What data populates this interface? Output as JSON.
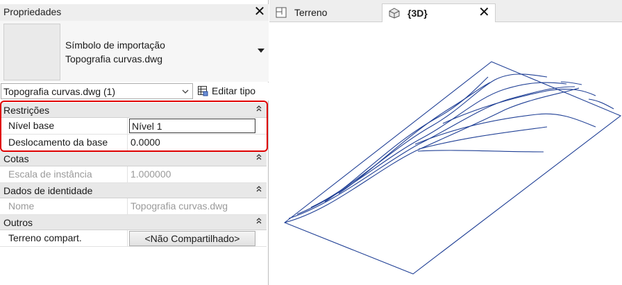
{
  "panel": {
    "title": "Propriedades",
    "close_glyph": "✕",
    "type_line1": "Símbolo de importação",
    "type_line2": "Topografia curvas.dwg",
    "instance_selector": "Topografia curvas.dwg (1)",
    "edit_type_label": "Editar tipo"
  },
  "sections": [
    {
      "label": "Restrições",
      "rows": [
        {
          "key": "Nível base",
          "value": "Nível 1",
          "kind": "input"
        },
        {
          "key": "Deslocamento da base",
          "value": "0.0000",
          "kind": "text"
        }
      ]
    },
    {
      "label": "Cotas",
      "rows": [
        {
          "key": "Escala de instância",
          "value": "1.000000",
          "kind": "dim"
        }
      ]
    },
    {
      "label": "Dados de identidade",
      "rows": [
        {
          "key": "Nome",
          "value": "Topografia curvas.dwg",
          "kind": "dim"
        }
      ]
    },
    {
      "label": "Outros",
      "rows": [
        {
          "key": "Terreno compart.",
          "value": "<Não Compartilhado>",
          "kind": "button"
        }
      ]
    }
  ],
  "tabs": [
    {
      "label": "Terreno",
      "icon": "floor-plan-icon",
      "active": false
    },
    {
      "label": "{3D}",
      "icon": "house-3d-icon",
      "active": true,
      "close_glyph": "✕"
    }
  ],
  "colors": {
    "highlight": "#e00000",
    "model_lines": "#1f3f95"
  }
}
